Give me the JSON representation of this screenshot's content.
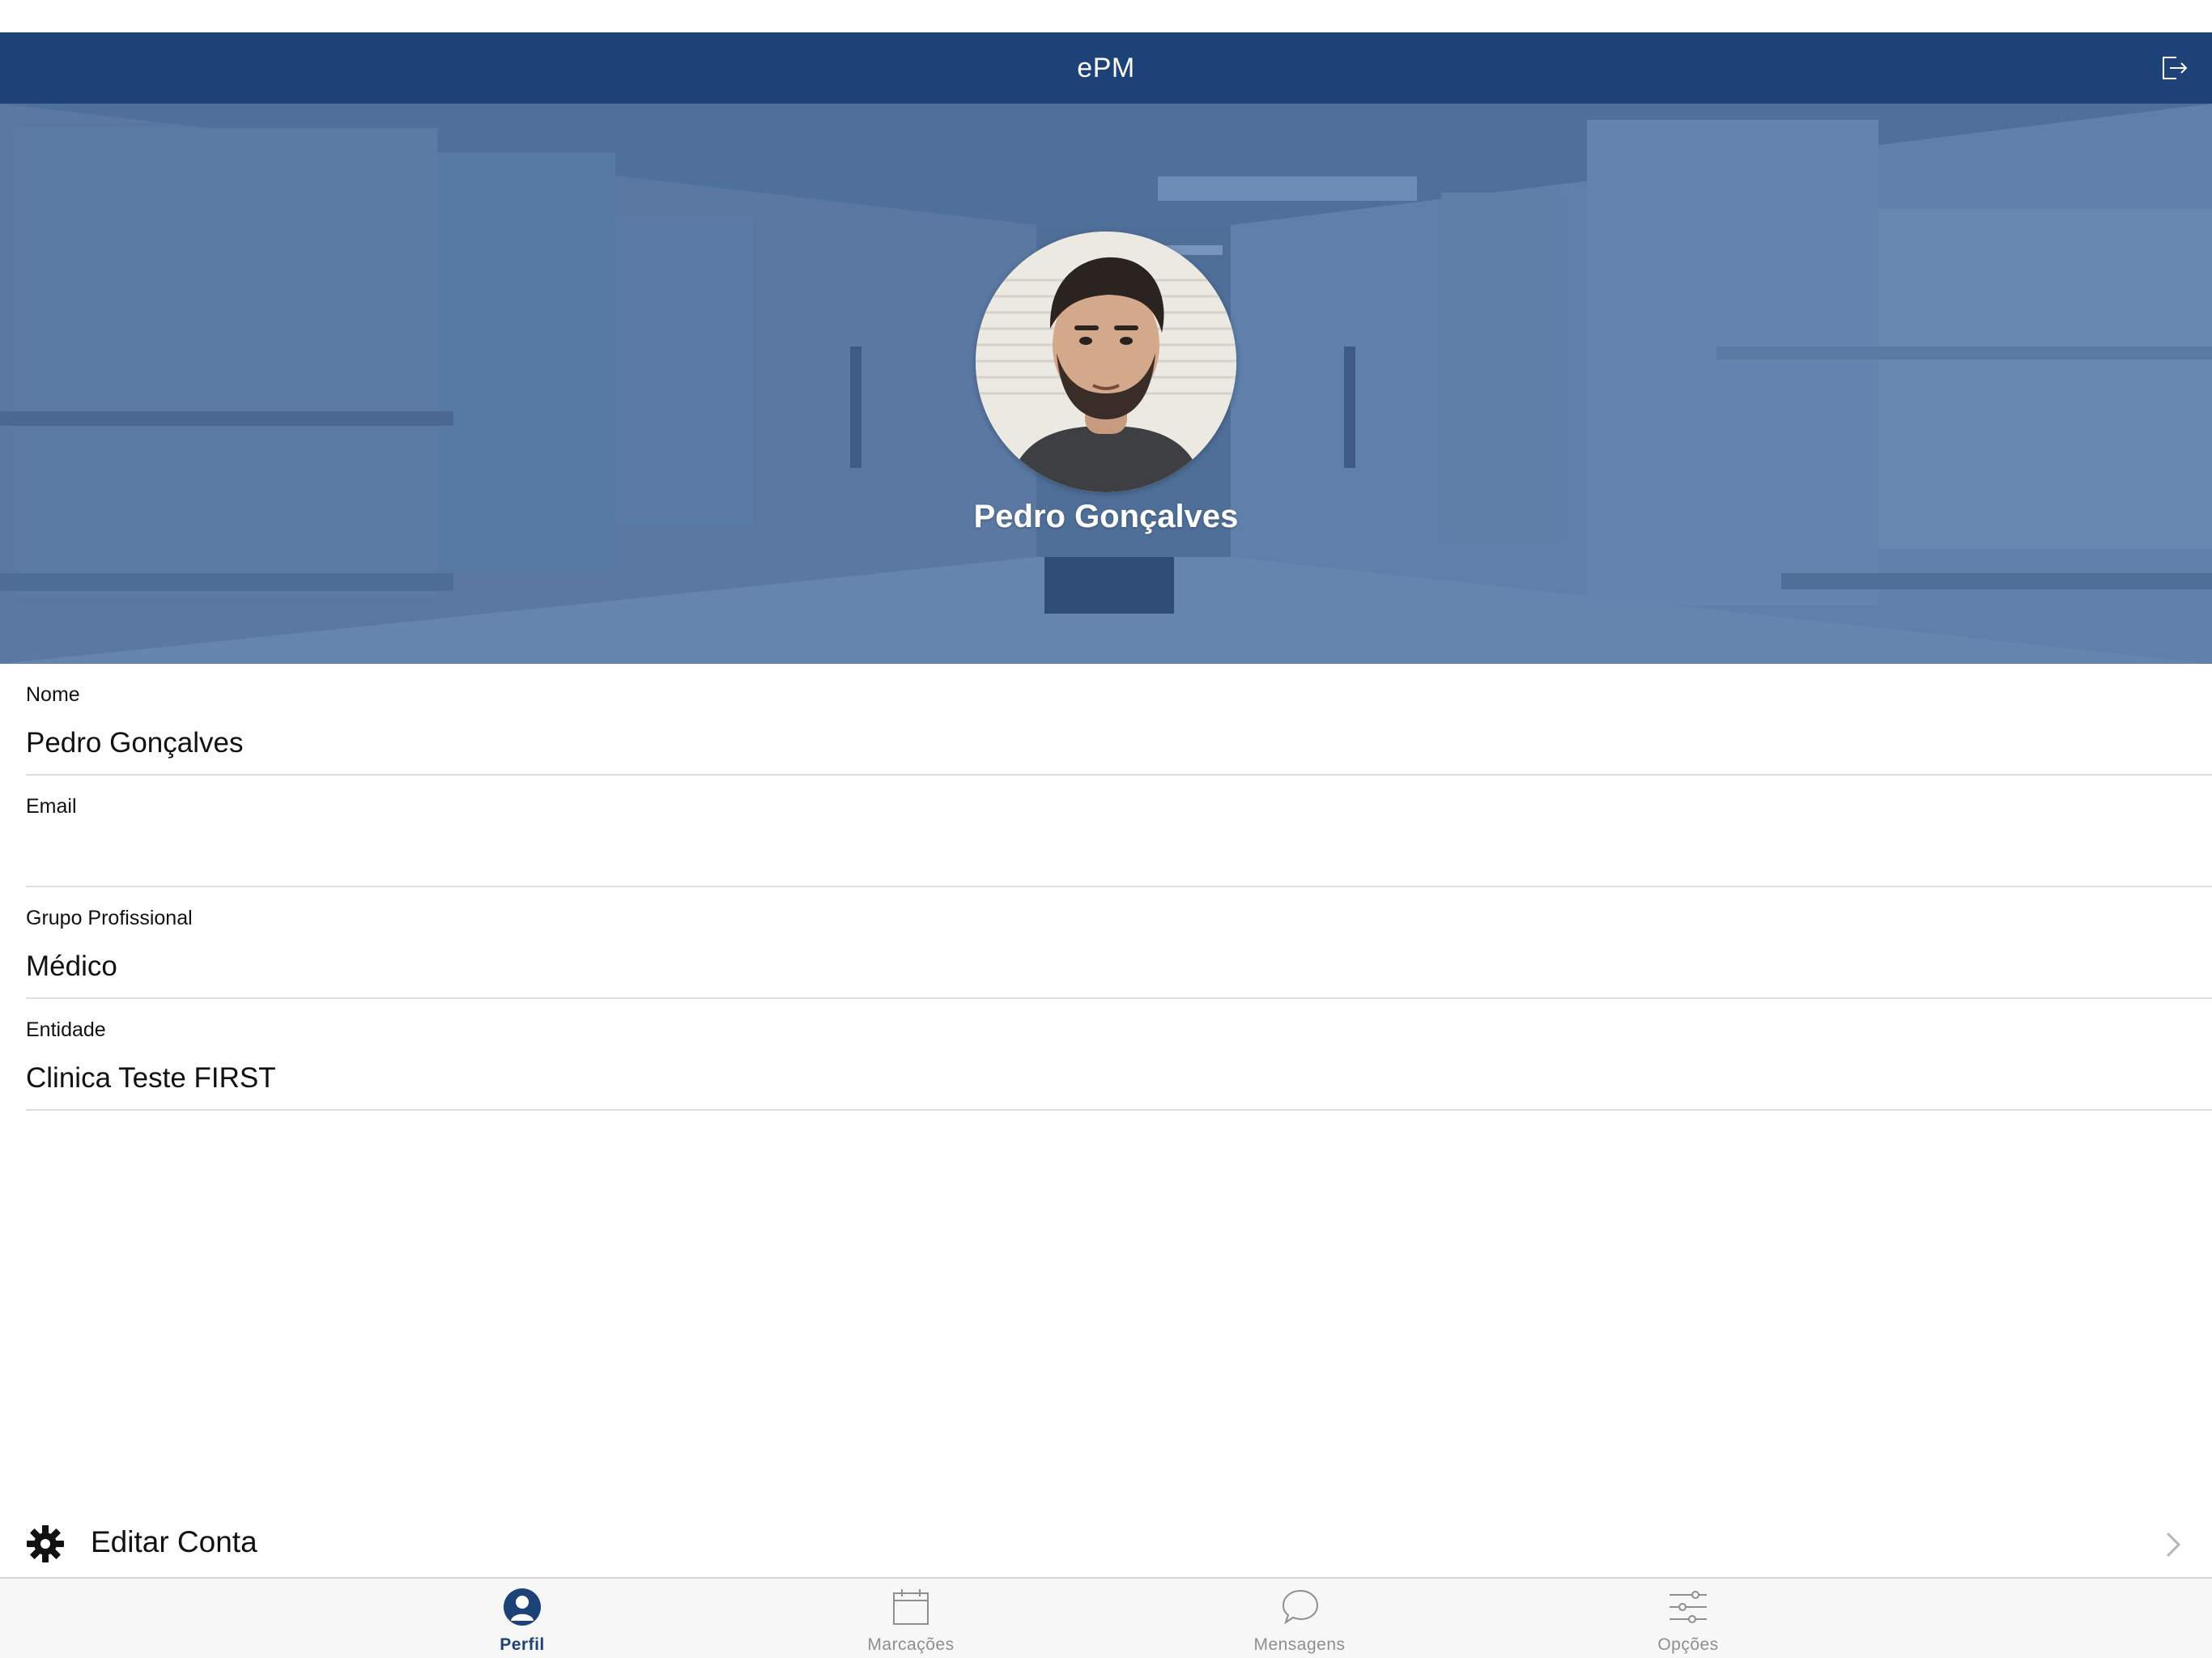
{
  "app": {
    "title": "ePM"
  },
  "nav": {
    "logout_icon": "logout-icon"
  },
  "profile": {
    "display_name": "Pedro Gonçalves",
    "avatar_icon": "user-avatar"
  },
  "fields": [
    {
      "label": "Nome",
      "value": "Pedro Gonçalves"
    },
    {
      "label": "Email",
      "value": ""
    },
    {
      "label": "Grupo Profissional",
      "value": "Médico"
    },
    {
      "label": "Entidade",
      "value": "Clinica Teste FIRST"
    }
  ],
  "actions": {
    "edit_account_label": "Editar Conta",
    "edit_account_icon": "gear-icon",
    "chevron_icon": "chevron-right-icon"
  },
  "tabs": [
    {
      "label": "Perfil",
      "icon": "person-icon",
      "active": true
    },
    {
      "label": "Marcações",
      "icon": "calendar-icon",
      "active": false
    },
    {
      "label": "Mensagens",
      "icon": "chat-icon",
      "active": false
    },
    {
      "label": "Opções",
      "icon": "sliders-icon",
      "active": false
    }
  ],
  "colors": {
    "brand": "#1d4278",
    "hero_overlay": "#5a7aa5",
    "tab_inactive": "#8e8e93",
    "separator": "#dcdcdc"
  }
}
